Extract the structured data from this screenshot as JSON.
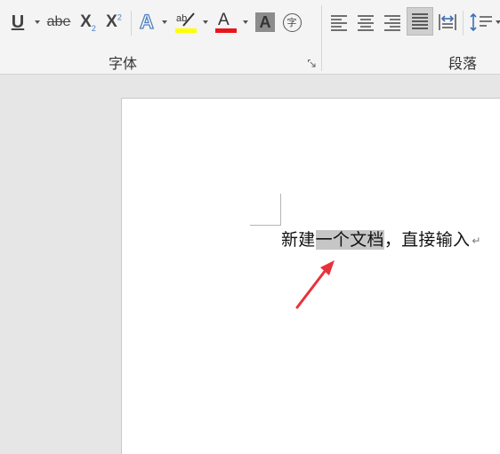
{
  "ribbon": {
    "underline_label": "U",
    "strike_label": "abe",
    "subscript_label": "X",
    "subscript_small": "2",
    "superscript_label": "X",
    "superscript_small": "2",
    "text_effect_label": "A",
    "highlight_label": "ab",
    "font_color_label": "A",
    "char_shading_label": "A",
    "encircle_label": "字",
    "font_group_label": "字体",
    "paragraph_group_label": "段落",
    "colors": {
      "highlight": "#ffff00",
      "font_color": "#e8151b",
      "text_effect": "#4f81bd"
    }
  },
  "document": {
    "before": "新建",
    "selected": "一个文档",
    "after": "，直接输入",
    "paragraph_mark": "↵",
    "annotation_color": "#e8323a"
  },
  "icons": [
    "underline-icon",
    "strikethrough-icon",
    "subscript-icon",
    "superscript-icon",
    "text-effect-icon",
    "highlight-icon",
    "font-color-icon",
    "char-shading-icon",
    "encircle-char-icon",
    "align-left-icon",
    "align-center-icon",
    "align-right-icon",
    "justify-icon",
    "distributed-icon",
    "line-spacing-icon",
    "dialog-launcher-icon",
    "arrow-annotation"
  ]
}
